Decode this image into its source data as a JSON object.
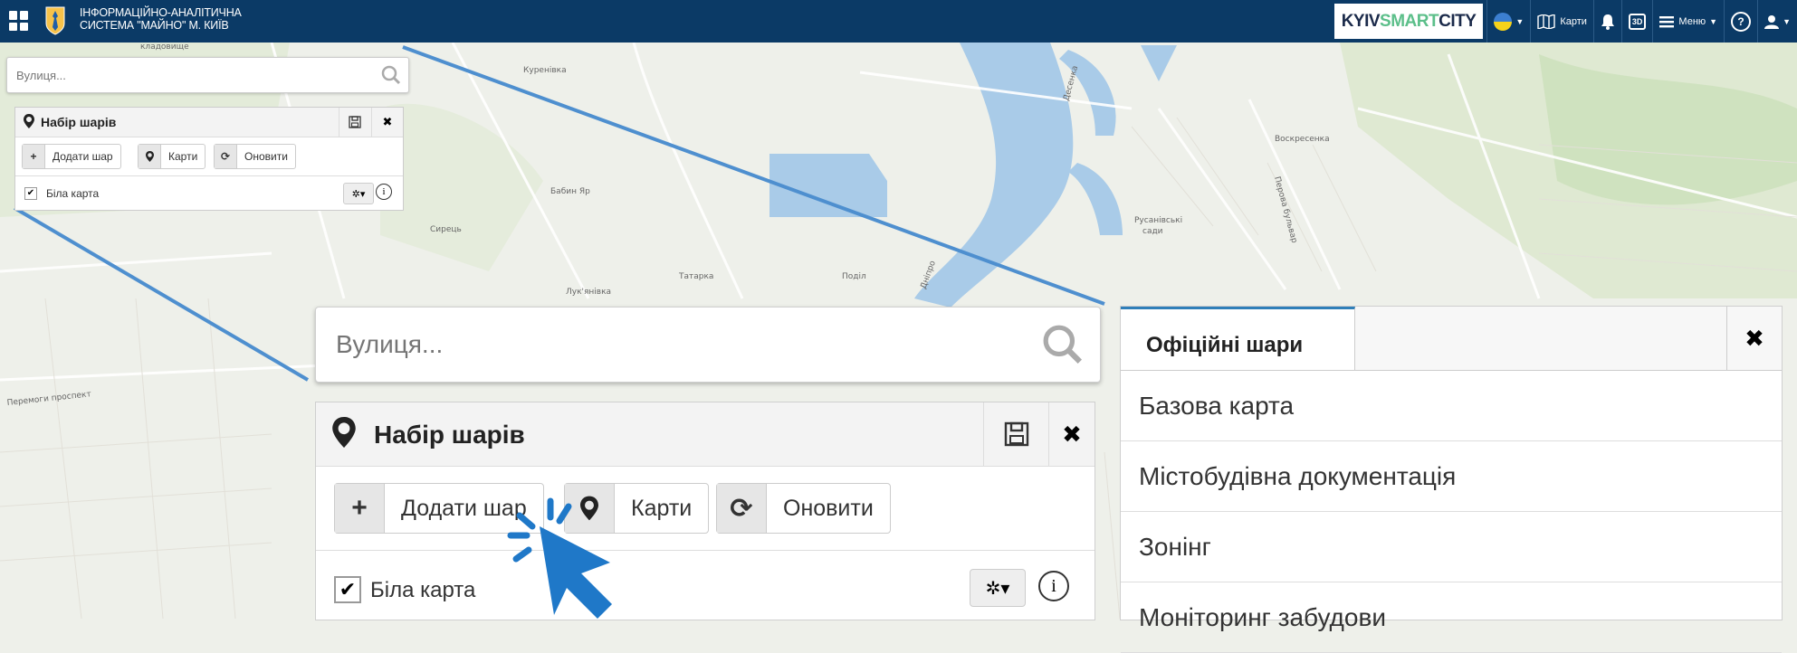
{
  "header": {
    "title_line1": "ІНФОРМАЦІЙНО-АНАЛІТИЧНА",
    "title_line2": "СИСТЕМА \"МАЙНО\" М. КИЇВ",
    "brand_part1": "KYIV",
    "brand_part2": "SMART",
    "brand_part3": "CITY",
    "maps_label": "Карти",
    "d3_label": "3D",
    "menu_label": "Меню",
    "help_label": "?"
  },
  "map_labels": {
    "kladovyshche": "кладовище",
    "kurenivka": "Куренівка",
    "babyn_yar": "Бабин Яр",
    "syrets": "Сирець",
    "tatarka": "Татарка",
    "podil": "Поділ",
    "lukianivka": "Лук'янівка",
    "dnipro": "Дніпро",
    "desenka": "Десенка",
    "voskresenka": "Воскресенка",
    "perova": "Перова бульвар",
    "rusanivski_1": "Русанівські",
    "rusanivski_2": "сади",
    "peremohy": "Перемоги проспект"
  },
  "small_panel": {
    "search_placeholder": "Вулиця...",
    "title": "Набір шарів",
    "add_layer": "Додати шар",
    "maps": "Карти",
    "refresh": "Оновити",
    "layer_name": "Біла карта"
  },
  "zoom_panel": {
    "search_placeholder": "Вулиця...",
    "title": "Набір шарів",
    "add_layer": "Додати шар",
    "maps": "Карти",
    "refresh": "Оновити",
    "layer_name": "Біла карта"
  },
  "official_layers": {
    "tab": "Офіційні шари",
    "items": [
      "Базова карта",
      "Містобудівна документація",
      "Зонінг",
      "Моніторинг забудови"
    ]
  },
  "colors": {
    "header_bg": "#0b3a66",
    "accent": "#2f7fb9",
    "water": "#a9cbe8",
    "cursor": "#1f78c8"
  }
}
